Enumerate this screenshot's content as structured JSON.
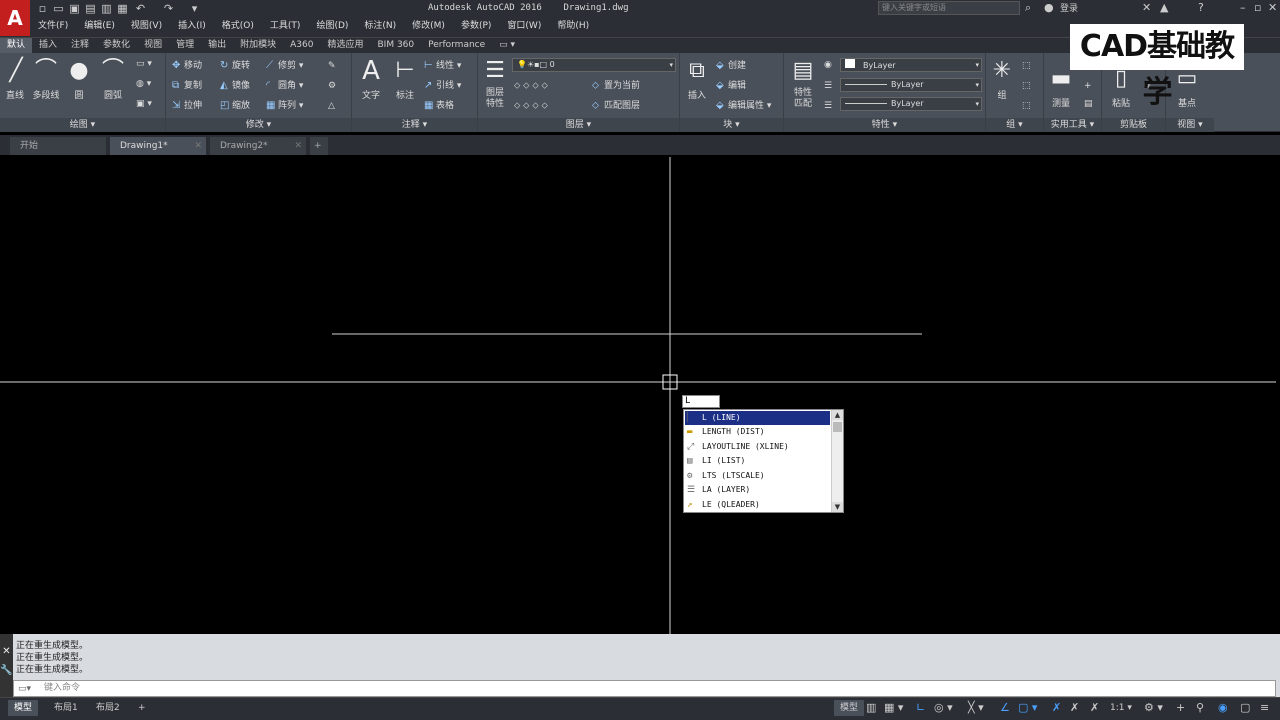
{
  "app": {
    "logo_letter": "A",
    "title": "Autodesk AutoCAD 2016    Drawing1.dwg",
    "search_placeholder": "键入关键字或短语",
    "login": "登录"
  },
  "menus": [
    "文件(F)",
    "编辑(E)",
    "视图(V)",
    "插入(I)",
    "格式(O)",
    "工具(T)",
    "绘图(D)",
    "标注(N)",
    "修改(M)",
    "参数(P)",
    "窗口(W)",
    "帮助(H)"
  ],
  "ribbon_tabs": [
    "默认",
    "插入",
    "注释",
    "参数化",
    "视图",
    "管理",
    "输出",
    "附加模块",
    "A360",
    "精选应用",
    "BIM 360",
    "Performance"
  ],
  "ribbon": {
    "draw": {
      "label": "绘图 ▾",
      "line": "直线",
      "polyline": "多段线",
      "circle": "圆",
      "arc": "圆弧"
    },
    "modify": {
      "label": "修改 ▾",
      "move": "移动",
      "rotate": "旋转",
      "trim": "修剪",
      "copy": "复制",
      "mirror": "镜像",
      "fillet": "圆角",
      "stretch": "拉伸",
      "scale": "缩放",
      "array": "阵列"
    },
    "annotation": {
      "label": "注释 ▾",
      "text": "文字",
      "dimension": "标注",
      "linear": "线性",
      "leader": "引线",
      "table": "表格"
    },
    "layers": {
      "label": "图层 ▾",
      "layer_props": "图层特性",
      "layer_value": "0",
      "set_current": "置为当前",
      "match_layer": "匹配图层"
    },
    "block": {
      "label": "块 ▾",
      "insert": "插入",
      "create": "创建",
      "edit": "编辑",
      "edit_attr": "编辑属性 ▾"
    },
    "properties": {
      "label": "特性 ▾",
      "match": "特性匹配",
      "color": "ByLayer",
      "linetype": "ByLayer",
      "lineweight": "ByLayer"
    },
    "groups": {
      "label": "组 ▾",
      "group": "组"
    },
    "utilities": {
      "label": "实用工具 ▾",
      "measure": "测量"
    },
    "clipboard": {
      "label": "剪贴板",
      "paste": "粘贴"
    },
    "view": {
      "label": "视图 ▾",
      "base": "基点"
    }
  },
  "watermark": "CAD基础教学",
  "doc_tabs": [
    "开始",
    "Drawing1*",
    "Drawing2*"
  ],
  "command": {
    "history": [
      "正在重生成模型。",
      "正在重生成模型。",
      "正在重生成模型。"
    ],
    "placeholder": "键入命令"
  },
  "dynamic_input": "L",
  "autocomplete": [
    "L (LINE)",
    "LENGTH (DIST)",
    "LAYOUTLINE (XLINE)",
    "LI (LIST)",
    "LTS (LTSCALE)",
    "LA (LAYER)",
    "LE (QLEADER)"
  ],
  "layout_tabs": [
    "模型",
    "布局1",
    "布局2"
  ],
  "status": {
    "model": "模型",
    "scale": "1:1 ▾"
  }
}
